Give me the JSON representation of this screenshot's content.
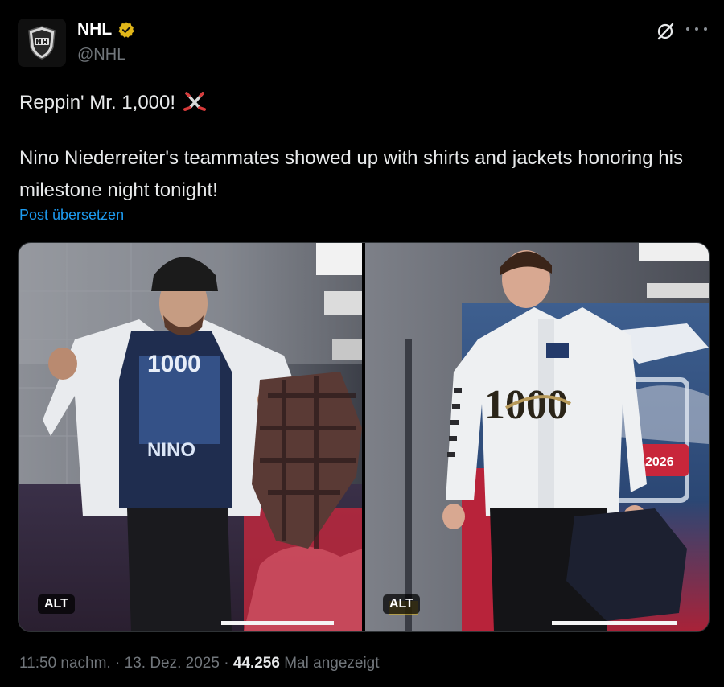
{
  "author": {
    "name": "NHL",
    "handle": "@NHL",
    "avatar_icon": "nhl-shield-logo",
    "verified_color": "#e2b719"
  },
  "post": {
    "line1": "Reppin' Mr. 1,000!",
    "line1_emoji": "crossed-hockey-sticks",
    "body": "Nino Niederreiter's teammates showed up with shirts and jackets honoring his milestone night tonight!",
    "translate_label": "Post übersetzen"
  },
  "media": [
    {
      "alt_label": "ALT",
      "shirt_text": "1000",
      "shirt_name": "NINO"
    },
    {
      "alt_label": "ALT",
      "jacket_text": "1000",
      "banner_year": "2026"
    }
  ],
  "meta": {
    "time": "11:50 nachm.",
    "sep1": " · ",
    "date": "13. Dez. 2025",
    "sep2": " · ",
    "views": "44.256",
    "views_label": " Mal angezeigt"
  },
  "colors": {
    "background": "#000000",
    "text": "#e7e9ea",
    "muted": "#71767b",
    "link": "#1d9bf0"
  }
}
